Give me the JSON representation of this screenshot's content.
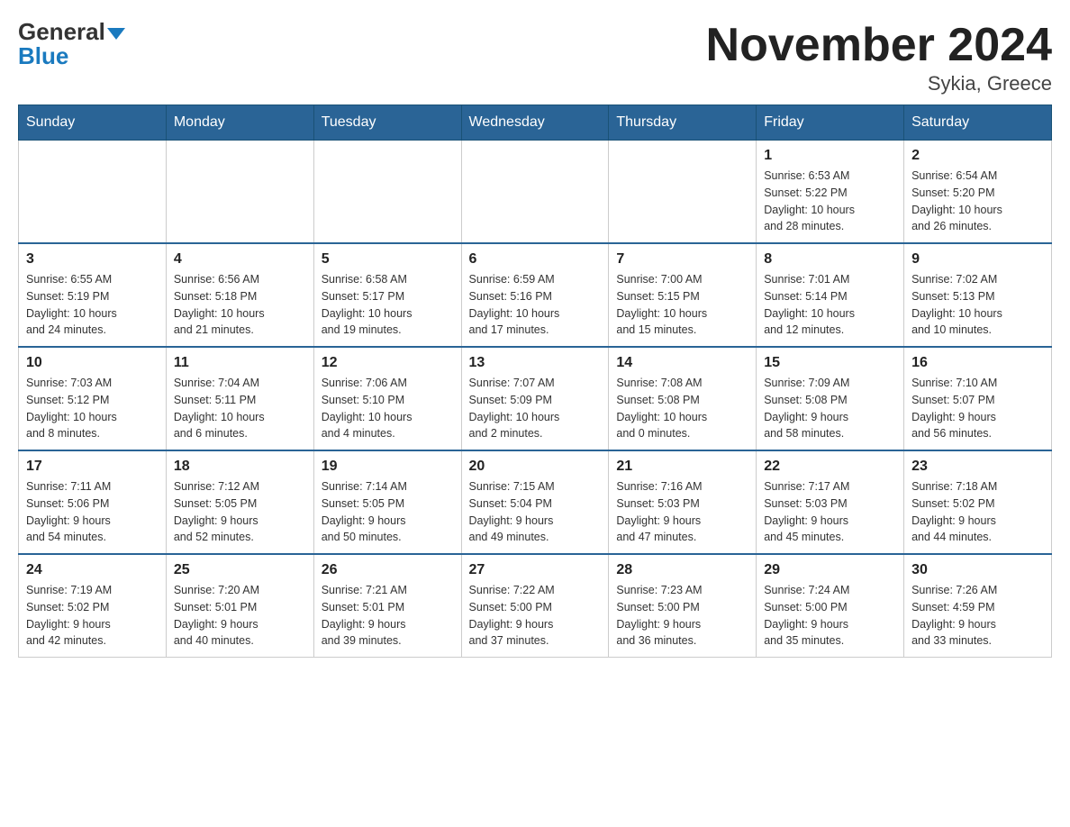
{
  "header": {
    "logo_general": "General",
    "logo_blue": "Blue",
    "month_title": "November 2024",
    "location": "Sykia, Greece"
  },
  "days_of_week": [
    "Sunday",
    "Monday",
    "Tuesday",
    "Wednesday",
    "Thursday",
    "Friday",
    "Saturday"
  ],
  "weeks": [
    {
      "days": [
        {
          "number": "",
          "info": ""
        },
        {
          "number": "",
          "info": ""
        },
        {
          "number": "",
          "info": ""
        },
        {
          "number": "",
          "info": ""
        },
        {
          "number": "",
          "info": ""
        },
        {
          "number": "1",
          "info": "Sunrise: 6:53 AM\nSunset: 5:22 PM\nDaylight: 10 hours\nand 28 minutes."
        },
        {
          "number": "2",
          "info": "Sunrise: 6:54 AM\nSunset: 5:20 PM\nDaylight: 10 hours\nand 26 minutes."
        }
      ]
    },
    {
      "days": [
        {
          "number": "3",
          "info": "Sunrise: 6:55 AM\nSunset: 5:19 PM\nDaylight: 10 hours\nand 24 minutes."
        },
        {
          "number": "4",
          "info": "Sunrise: 6:56 AM\nSunset: 5:18 PM\nDaylight: 10 hours\nand 21 minutes."
        },
        {
          "number": "5",
          "info": "Sunrise: 6:58 AM\nSunset: 5:17 PM\nDaylight: 10 hours\nand 19 minutes."
        },
        {
          "number": "6",
          "info": "Sunrise: 6:59 AM\nSunset: 5:16 PM\nDaylight: 10 hours\nand 17 minutes."
        },
        {
          "number": "7",
          "info": "Sunrise: 7:00 AM\nSunset: 5:15 PM\nDaylight: 10 hours\nand 15 minutes."
        },
        {
          "number": "8",
          "info": "Sunrise: 7:01 AM\nSunset: 5:14 PM\nDaylight: 10 hours\nand 12 minutes."
        },
        {
          "number": "9",
          "info": "Sunrise: 7:02 AM\nSunset: 5:13 PM\nDaylight: 10 hours\nand 10 minutes."
        }
      ]
    },
    {
      "days": [
        {
          "number": "10",
          "info": "Sunrise: 7:03 AM\nSunset: 5:12 PM\nDaylight: 10 hours\nand 8 minutes."
        },
        {
          "number": "11",
          "info": "Sunrise: 7:04 AM\nSunset: 5:11 PM\nDaylight: 10 hours\nand 6 minutes."
        },
        {
          "number": "12",
          "info": "Sunrise: 7:06 AM\nSunset: 5:10 PM\nDaylight: 10 hours\nand 4 minutes."
        },
        {
          "number": "13",
          "info": "Sunrise: 7:07 AM\nSunset: 5:09 PM\nDaylight: 10 hours\nand 2 minutes."
        },
        {
          "number": "14",
          "info": "Sunrise: 7:08 AM\nSunset: 5:08 PM\nDaylight: 10 hours\nand 0 minutes."
        },
        {
          "number": "15",
          "info": "Sunrise: 7:09 AM\nSunset: 5:08 PM\nDaylight: 9 hours\nand 58 minutes."
        },
        {
          "number": "16",
          "info": "Sunrise: 7:10 AM\nSunset: 5:07 PM\nDaylight: 9 hours\nand 56 minutes."
        }
      ]
    },
    {
      "days": [
        {
          "number": "17",
          "info": "Sunrise: 7:11 AM\nSunset: 5:06 PM\nDaylight: 9 hours\nand 54 minutes."
        },
        {
          "number": "18",
          "info": "Sunrise: 7:12 AM\nSunset: 5:05 PM\nDaylight: 9 hours\nand 52 minutes."
        },
        {
          "number": "19",
          "info": "Sunrise: 7:14 AM\nSunset: 5:05 PM\nDaylight: 9 hours\nand 50 minutes."
        },
        {
          "number": "20",
          "info": "Sunrise: 7:15 AM\nSunset: 5:04 PM\nDaylight: 9 hours\nand 49 minutes."
        },
        {
          "number": "21",
          "info": "Sunrise: 7:16 AM\nSunset: 5:03 PM\nDaylight: 9 hours\nand 47 minutes."
        },
        {
          "number": "22",
          "info": "Sunrise: 7:17 AM\nSunset: 5:03 PM\nDaylight: 9 hours\nand 45 minutes."
        },
        {
          "number": "23",
          "info": "Sunrise: 7:18 AM\nSunset: 5:02 PM\nDaylight: 9 hours\nand 44 minutes."
        }
      ]
    },
    {
      "days": [
        {
          "number": "24",
          "info": "Sunrise: 7:19 AM\nSunset: 5:02 PM\nDaylight: 9 hours\nand 42 minutes."
        },
        {
          "number": "25",
          "info": "Sunrise: 7:20 AM\nSunset: 5:01 PM\nDaylight: 9 hours\nand 40 minutes."
        },
        {
          "number": "26",
          "info": "Sunrise: 7:21 AM\nSunset: 5:01 PM\nDaylight: 9 hours\nand 39 minutes."
        },
        {
          "number": "27",
          "info": "Sunrise: 7:22 AM\nSunset: 5:00 PM\nDaylight: 9 hours\nand 37 minutes."
        },
        {
          "number": "28",
          "info": "Sunrise: 7:23 AM\nSunset: 5:00 PM\nDaylight: 9 hours\nand 36 minutes."
        },
        {
          "number": "29",
          "info": "Sunrise: 7:24 AM\nSunset: 5:00 PM\nDaylight: 9 hours\nand 35 minutes."
        },
        {
          "number": "30",
          "info": "Sunrise: 7:26 AM\nSunset: 4:59 PM\nDaylight: 9 hours\nand 33 minutes."
        }
      ]
    }
  ]
}
